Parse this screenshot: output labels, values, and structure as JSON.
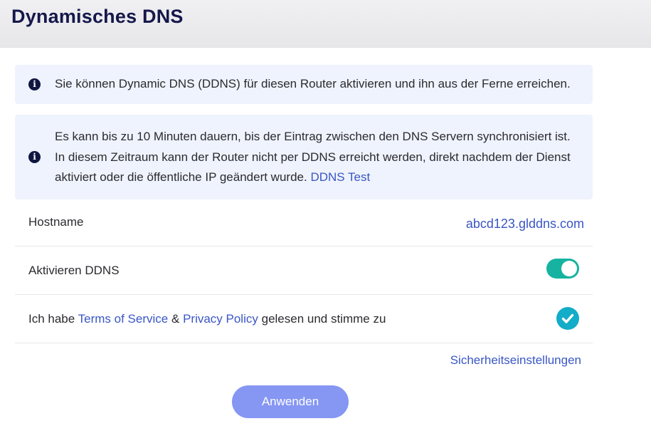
{
  "page": {
    "title": "Dynamisches DNS"
  },
  "info_boxes": [
    {
      "icon": "info-icon",
      "text": "Sie können Dynamic DNS (DDNS) für diesen Router aktivieren und ihn aus der Ferne erreichen."
    },
    {
      "icon": "info-icon",
      "text_line1": "Es kann bis zu 10 Minuten dauern, bis der Eintrag zwischen den DNS Servern synchronisiert ist.",
      "text_line2": "In diesem Zeitraum kann der Router nicht per DDNS erreicht werden, direkt nachdem der Dienst",
      "text_line3": "aktiviert oder die öffentliche IP geändert wurde.",
      "link": "DDNS Test"
    }
  ],
  "settings": {
    "hostname": {
      "label": "Hostname",
      "value": "abcd123.glddns.com"
    },
    "enable_ddns": {
      "label": "Aktivieren DDNS",
      "enabled": true
    },
    "terms": {
      "prefix": "Ich habe",
      "terms_link": "Terms of Service",
      "ampersand": "&",
      "privacy_link": "Privacy Policy",
      "suffix": "gelesen und stimme zu",
      "accepted": true
    }
  },
  "security_link": "Sicherheitseinstellungen",
  "apply_button": "Anwenden",
  "colors": {
    "title": "#15184a",
    "link": "#3a56c5",
    "info_background": "#eff3fd",
    "toggle_on": "#16b3a1",
    "check": "#13acc9",
    "button": "#8596f3"
  }
}
